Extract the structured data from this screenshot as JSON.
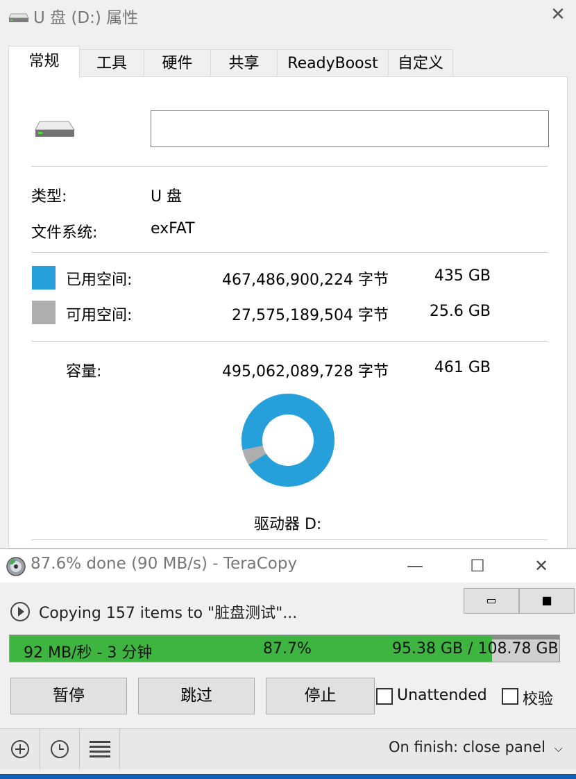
{
  "properties": {
    "title": "U 盘 (D:) 属性",
    "tabs": [
      "常规",
      "工具",
      "硬件",
      "共享",
      "ReadyBoost",
      "自定义"
    ],
    "name_value": "",
    "type_label": "类型:",
    "type_value": "U 盘",
    "fs_label": "文件系统:",
    "fs_value": "exFAT",
    "used": {
      "label": "已用空间:",
      "bytes": "467,486,900,224 字节",
      "size": "435 GB",
      "color": "#26a0da"
    },
    "free": {
      "label": "可用空间:",
      "bytes": "27,575,189,504 字节",
      "size": "25.6 GB",
      "color": "#aeaeae"
    },
    "capacity": {
      "label": "容量:",
      "bytes": "495,062,089,728 字节",
      "size": "461 GB"
    },
    "used_fraction": 0.944,
    "drive_label": "驱动器 D:"
  },
  "teracopy": {
    "title": "87.6% done (90 MB/s) - TeraCopy",
    "status": "Copying 157 items to \"脏盘测试\"...",
    "progress": {
      "speed_eta": "92 MB/秒 - 3 分钟",
      "percent_text": "87.7%",
      "size_text": "95.38 GB / 108.78 GB",
      "fraction": 0.877
    },
    "buttons": {
      "pause": "暂停",
      "skip": "跳过",
      "stop": "停止"
    },
    "checkboxes": {
      "unattended": "Unattended",
      "verify": "校验"
    },
    "finish": "On finish: close panel",
    "colors": {
      "progress": "#3db540",
      "accent": "#26a0da"
    }
  }
}
